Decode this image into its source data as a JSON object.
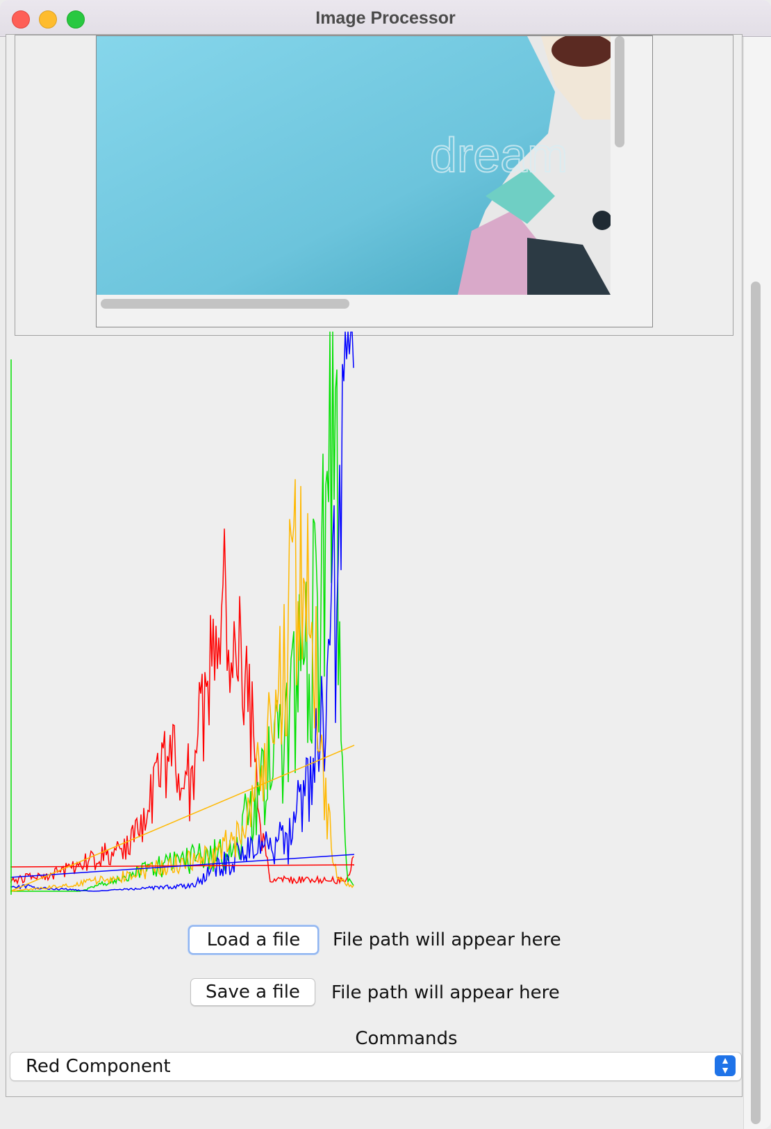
{
  "window": {
    "title": "Image Processor"
  },
  "image": {
    "watermark": "dream"
  },
  "histogram": {
    "series": [
      {
        "name": "red",
        "color": "#ff0000"
      },
      {
        "name": "green",
        "color": "#00e000"
      },
      {
        "name": "blue",
        "color": "#0000ff"
      },
      {
        "name": "intensity",
        "color": "#ffb800"
      }
    ]
  },
  "load": {
    "button_label": "Load a file",
    "path_text": "File path will appear here"
  },
  "save": {
    "button_label": "Save a file",
    "path_text": "File path will appear here"
  },
  "commands": {
    "label": "Commands",
    "selected": "Red Component"
  }
}
